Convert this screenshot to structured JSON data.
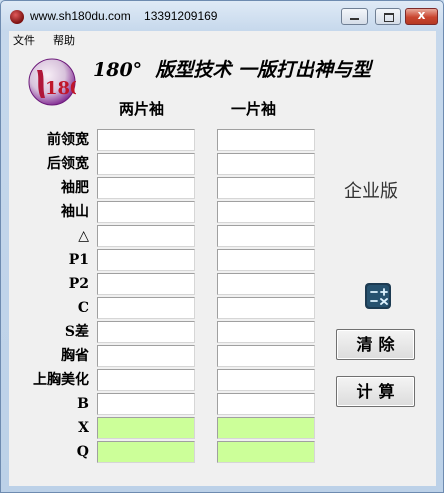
{
  "window": {
    "title": "www.sh180du.com    13391209169",
    "minimize": "minimize",
    "maximize": "maximize",
    "close": "x"
  },
  "menu": [
    "文件",
    "帮助"
  ],
  "header": {
    "logo_text": "180°",
    "title": "180°  版型技术 一版打出神与型"
  },
  "columns": [
    "两片袖",
    "一片袖"
  ],
  "rows": [
    {
      "label": "前领宽",
      "values": [
        "",
        ""
      ],
      "highlight": false
    },
    {
      "label": "后领宽",
      "values": [
        "",
        ""
      ],
      "highlight": false
    },
    {
      "label": "袖肥",
      "values": [
        "",
        ""
      ],
      "highlight": false
    },
    {
      "label": "袖山",
      "values": [
        "",
        ""
      ],
      "highlight": false
    },
    {
      "label": "△",
      "values": [
        "",
        ""
      ],
      "highlight": false
    },
    {
      "label": "P1",
      "values": [
        "",
        ""
      ],
      "highlight": false
    },
    {
      "label": "P2",
      "values": [
        "",
        ""
      ],
      "highlight": false
    },
    {
      "label": "C",
      "values": [
        "",
        ""
      ],
      "highlight": false
    },
    {
      "label": "S差",
      "values": [
        "",
        ""
      ],
      "highlight": false
    },
    {
      "label": "胸省",
      "values": [
        "",
        ""
      ],
      "highlight": false
    },
    {
      "label": "上胸美化",
      "values": [
        "",
        ""
      ],
      "highlight": false
    },
    {
      "label": "B",
      "values": [
        "",
        ""
      ],
      "highlight": false
    },
    {
      "label": "X",
      "values": [
        "",
        ""
      ],
      "highlight": true
    },
    {
      "label": "Q",
      "values": [
        "",
        ""
      ],
      "highlight": true
    }
  ],
  "edition": "企业版",
  "buttons": {
    "clear": "清除",
    "compute": "计算"
  },
  "icons": {
    "calculator": "calculator-icon",
    "app": "app-logo-icon"
  },
  "colors": {
    "highlight_field": "#ccff99",
    "logo_red": "#c0162a",
    "logo_purple": "#7a1c8c"
  }
}
